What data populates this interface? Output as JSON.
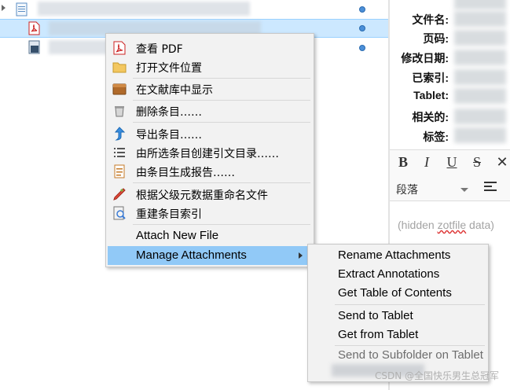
{
  "right_pane": {
    "fields": [
      {
        "label": "文件名:"
      },
      {
        "label": "页码:"
      },
      {
        "label": "修改日期:"
      },
      {
        "label": "已索引:"
      },
      {
        "label": "Tablet:"
      },
      {
        "label": "相关的:"
      },
      {
        "label": "标签:"
      }
    ],
    "paragraph_style": "段落",
    "hidden_note": "(hidden zotfile data)"
  },
  "context_menu": {
    "items": [
      {
        "label": "查看 PDF",
        "icon": "pdf-icon"
      },
      {
        "label": "打开文件位置",
        "icon": "folder-icon"
      },
      {
        "label": "在文献库中显示",
        "icon": "library-icon"
      },
      {
        "label": "删除条目……",
        "icon": "trash-icon"
      },
      {
        "label": "导出条目……",
        "icon": "export-icon"
      },
      {
        "label": "由所选条目创建引文目录……",
        "icon": "bibliography-icon"
      },
      {
        "label": "由条目生成报告……",
        "icon": "report-icon"
      },
      {
        "label": "根据父级元数据重命名文件",
        "icon": "rename-icon"
      },
      {
        "label": "重建条目索引",
        "icon": "reindex-icon"
      },
      {
        "label": "Attach New File",
        "icon": ""
      },
      {
        "label": "Manage Attachments",
        "icon": ""
      }
    ]
  },
  "submenu": {
    "items": [
      {
        "label": "Rename Attachments"
      },
      {
        "label": "Extract Annotations"
      },
      {
        "label": "Get Table of Contents"
      },
      {
        "label": "Send to Tablet"
      },
      {
        "label": "Get from Tablet"
      },
      {
        "label": "Send to Subfolder on Tablet"
      }
    ]
  },
  "watermark": "CSDN @全国快乐男生总冠军",
  "colors": {
    "highlight": "#91c9f7",
    "selected_row": "#cce8ff",
    "menu_bg": "#f2f2f2"
  }
}
